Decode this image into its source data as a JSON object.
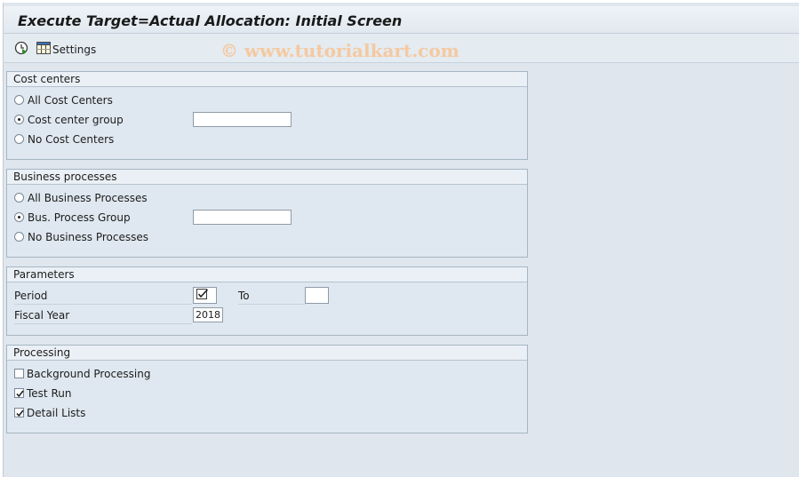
{
  "window": {
    "title": "Execute Target=Actual Allocation: Initial Screen"
  },
  "toolbar": {
    "execute_icon": "execute-clock-icon",
    "settings_icon": "settings-grid-icon",
    "settings_label": "Settings"
  },
  "watermark": "© www.tutorialkart.com",
  "cost_centers": {
    "header": "Cost centers",
    "options": [
      {
        "label": "All Cost Centers",
        "selected": false
      },
      {
        "label": "Cost center group",
        "selected": true
      },
      {
        "label": "No Cost Centers",
        "selected": false
      }
    ],
    "group_value": ""
  },
  "business_processes": {
    "header": "Business processes",
    "options": [
      {
        "label": "All Business Processes",
        "selected": false
      },
      {
        "label": "Bus. Process Group",
        "selected": true
      },
      {
        "label": "No Business Processes",
        "selected": false
      }
    ],
    "group_value": ""
  },
  "parameters": {
    "header": "Parameters",
    "period_label": "Period",
    "period_checked": true,
    "to_label": "To",
    "to_value": "",
    "fiscal_year_label": "Fiscal Year",
    "fiscal_year_value": "2018"
  },
  "processing": {
    "header": "Processing",
    "options": [
      {
        "label": "Background Processing",
        "checked": false
      },
      {
        "label": "Test Run",
        "checked": true
      },
      {
        "label": "Detail Lists",
        "checked": true
      }
    ]
  },
  "colors": {
    "background": "#dfe6ed",
    "group_border": "#a6b5c3",
    "watermark": "#f5c9a0"
  }
}
